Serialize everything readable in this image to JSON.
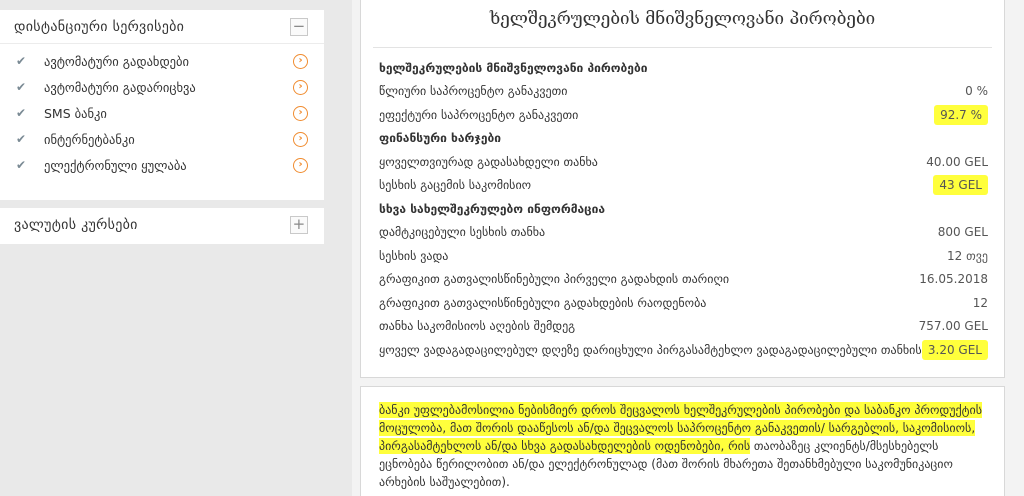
{
  "sidebar": {
    "remote_services": {
      "title": "დისტანციური სერვისები",
      "toggle": "−",
      "items": [
        {
          "label": "ავტომატური გადახდები"
        },
        {
          "label": "ავტომატური გადარიცხვა"
        },
        {
          "label": "SMS ბანკი"
        },
        {
          "label": "ინტერნეტბანკი"
        },
        {
          "label": "ელექტრონული ყულაბა"
        }
      ]
    },
    "currency_rates": {
      "title": "ვალუტის კურსები",
      "toggle": "+"
    }
  },
  "card": {
    "title": "ხელშეკრულების მნიშვნელოვანი პირობები",
    "rows": [
      {
        "label": "ხელშეკრულების მნიშვნელოვანი პირობები",
        "value": "",
        "section": true
      },
      {
        "label": "წლიური საპროცენტო განაკვეთი",
        "value": "0 %"
      },
      {
        "label": "ეფექტური საპროცენტო განაკვეთი",
        "value": "92.7 %",
        "highlight": true
      },
      {
        "label": "ფინანსური ხარჯები",
        "value": "",
        "section": true
      },
      {
        "label": "ყოველთვიურად გადასახდელი თანხა",
        "value": "40.00 GEL"
      },
      {
        "label": "სესხის გაცემის საკომისიო",
        "value": "43 GEL",
        "highlight": true
      },
      {
        "label": "სხვა სახელშეკრულებო ინფორმაცია",
        "value": "",
        "section": true
      },
      {
        "label": "დამტკიცებული სესხის თანხა",
        "value": "800 GEL"
      },
      {
        "label": "სესხის ვადა",
        "value": "12 თვე"
      },
      {
        "label": "გრაფიკით გათვალისწინებული პირველი გადახდის თარიღი",
        "value": "16.05.2018"
      },
      {
        "label": "გრაფიკით გათვალისწინებული გადახდების რაოდენობა",
        "value": "12"
      },
      {
        "label": "თანხა საკომისიოს აღების შემდეგ",
        "value": "757.00 GEL"
      },
      {
        "label": "ყოველ ვადაგადაცილებულ დღეზე დარიცხული პირგასამტეხლო ვადაგადაცილებული თანხის",
        "value": "3.20 GEL",
        "highlight": true
      }
    ]
  },
  "note": {
    "highlighted_text": "ბანკი უფლებამოსილია ნებისმიერ დროს შეცვალოს ხელშეკრულების პირობები და საბანკო პროდუქტის მოცულობა, მათ შორის დააწესოს ან/და შეცვალოს საპროცენტო განაკვეთის/ სარგებლის, საკომისიოს, პირგასამტეხლოს ან/და სხვა გადასახდელების ოდენობები, რის",
    "plain_text": " თაობაზეც კლიენტს/მსესხებელს ეცნობება წერილობით ან/და ელექტრონულად (მათ შორის მხარეთა შეთანხმებული საკომუნიკაციო არხების საშუალებით)."
  },
  "colors": {
    "highlight": "#ffff3c",
    "accent_orange": "#f08c30",
    "page_bg": "#e9e9e9"
  }
}
